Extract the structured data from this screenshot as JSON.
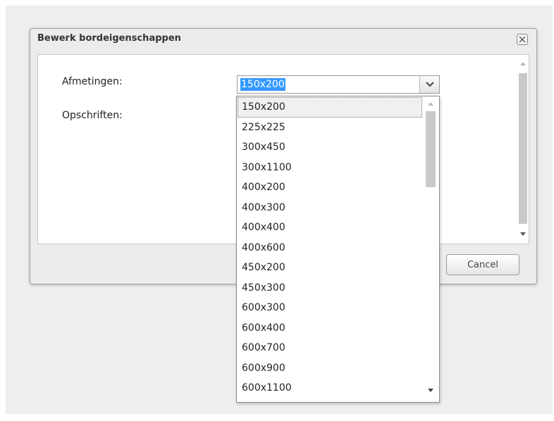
{
  "dialog": {
    "title": "Bewerk bordeigenschappen",
    "fields": {
      "size_label": "Afmetingen:",
      "captions_label": "Opschriften:"
    },
    "cancel_label": "Cancel"
  },
  "size_select": {
    "value": "150x200",
    "options": [
      "150x200",
      "225x225",
      "300x450",
      "300x1100",
      "400x200",
      "400x300",
      "400x400",
      "400x600",
      "450x200",
      "450x300",
      "600x300",
      "600x400",
      "600x700",
      "600x900",
      "600x1100"
    ],
    "selected_index": 0
  },
  "icons": {
    "close": "close-icon",
    "chevron": "chevron-down-icon",
    "scroll_up": "arrow-up-icon",
    "scroll_down": "arrow-down-icon"
  },
  "colors": {
    "selection_highlight": "#3399ff",
    "dialog_background": "#ececec",
    "scrollbar_thumb": "#c9c9c9"
  }
}
